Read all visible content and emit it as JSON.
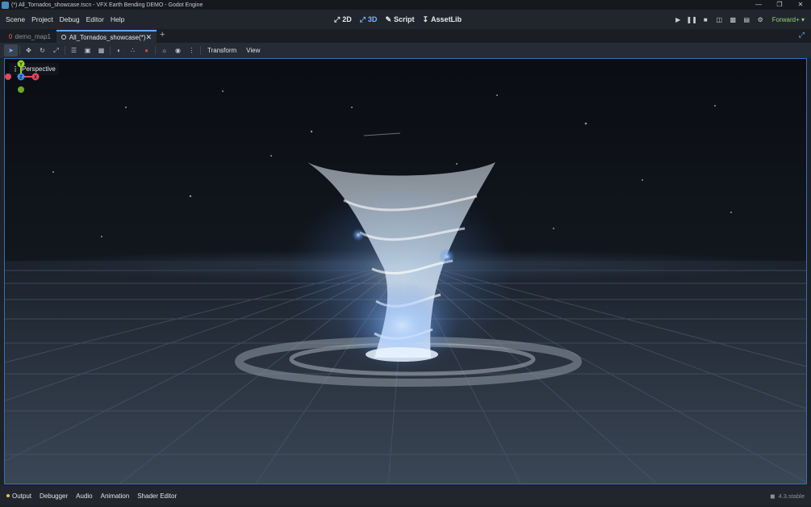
{
  "window": {
    "title": "(*) All_Tornados_showcase.tscn - VFX Earth Bending DEMO - Godot Engine",
    "controls": [
      "minimize-icon",
      "restore-icon",
      "close-icon"
    ]
  },
  "menubar": {
    "menus": [
      "Scene",
      "Project",
      "Debug",
      "Editor",
      "Help"
    ],
    "workspaces": [
      {
        "label": "2D",
        "icon": "2d-icon"
      },
      {
        "label": "3D",
        "icon": "3d-icon",
        "active": true
      },
      {
        "label": "Script",
        "icon": "script-icon"
      },
      {
        "label": "AssetLib",
        "icon": "assetlib-icon"
      }
    ],
    "run_buttons": [
      "play-icon",
      "pause-icon",
      "stop-icon",
      "remote-debug-icon",
      "play-scene-icon",
      "play-custom-scene-icon",
      "movie-maker-icon"
    ],
    "renderer": "Forward+"
  },
  "tabs": [
    {
      "label": "demo_map1",
      "active": false
    },
    {
      "label": "All_Tornados_showcase(*)",
      "active": true
    }
  ],
  "toolbar": {
    "tools": [
      "select-icon",
      "move-icon",
      "rotate-icon",
      "scale-icon",
      "list-select-icon",
      "lock-icon",
      "group-icon",
      "ruler-icon",
      "local-space-icon",
      "snap-icon",
      "sun-icon",
      "environment-icon",
      "more-icon"
    ],
    "menus": [
      "Transform",
      "View"
    ]
  },
  "viewport": {
    "mode_label": "Perspective",
    "gizmo_axes": [
      "Y",
      "Z",
      "X"
    ]
  },
  "bottom_panel": {
    "tabs": [
      "Output",
      "Debugger",
      "Audio",
      "Animation",
      "Shader Editor"
    ],
    "version": "4.3.stable"
  },
  "colors": {
    "accent": "#6aa7ff",
    "renderer": "#8ed46d",
    "axis_x": "#e04a5a",
    "axis_y": "#8ed42a",
    "axis_z": "#3d8fe6"
  }
}
